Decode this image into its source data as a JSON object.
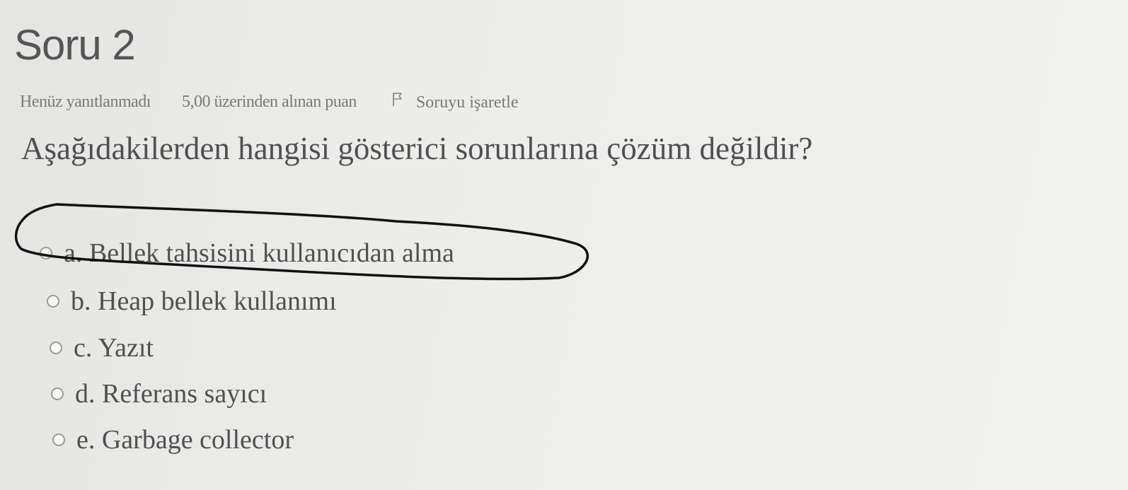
{
  "question": {
    "title": "Soru 2",
    "state": "Henüz yanıtlanmadı",
    "grade": "5,00 üzerinden alınan puan",
    "flag_label": "Soruyu işaretle",
    "flag_icon": "flag-icon",
    "text": "Aşağıdakilerden hangisi gösterici sorunlarına çözüm değildir?"
  },
  "answers": [
    {
      "label": "a. Bellek tahsisini kullanıcıdan alma",
      "selected": false
    },
    {
      "label": "b. Heap bellek kullanımı",
      "selected": false
    },
    {
      "label": "c. Yazıt",
      "selected": false
    },
    {
      "label": "d. Referans sayıcı",
      "selected": false
    },
    {
      "label": "e. Garbage collector",
      "selected": false
    }
  ],
  "annotation": {
    "type": "hand-drawn circle around option a",
    "color": "#111111"
  }
}
